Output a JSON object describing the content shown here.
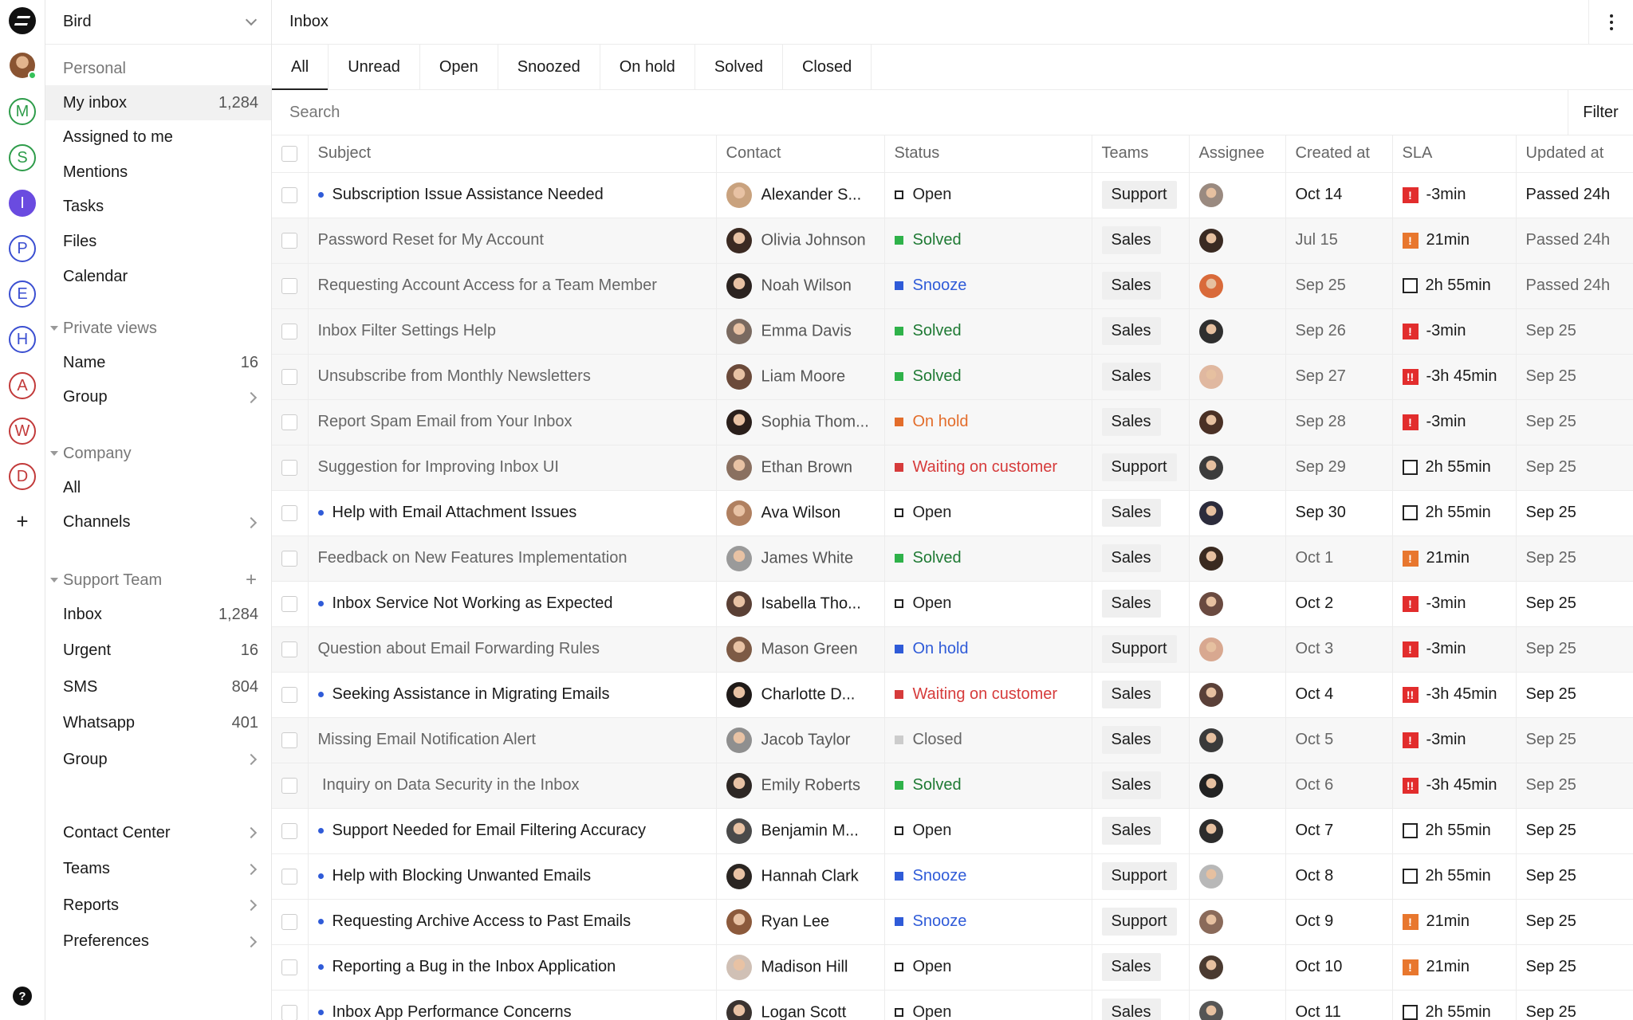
{
  "app": {
    "workspace": "Bird",
    "page_title": "Inbox"
  },
  "rail": {
    "items": [
      {
        "name": "logo",
        "letter": "",
        "color": "#111111"
      },
      {
        "name": "user-avatar",
        "letter": "",
        "color": "#b0703d"
      },
      {
        "name": "M",
        "letter": "M",
        "color": "#2e9c4a"
      },
      {
        "name": "S",
        "letter": "S",
        "color": "#2e9c4a"
      },
      {
        "name": "I",
        "letter": "I",
        "color": "#6a4be0",
        "filled": true
      },
      {
        "name": "P",
        "letter": "P",
        "color": "#3b4fd1"
      },
      {
        "name": "E",
        "letter": "E",
        "color": "#3b4fd1"
      },
      {
        "name": "H",
        "letter": "H",
        "color": "#3b4fd1"
      },
      {
        "name": "A",
        "letter": "A",
        "color": "#c23a3a"
      },
      {
        "name": "W",
        "letter": "W",
        "color": "#c23a3a"
      },
      {
        "name": "D",
        "letter": "D",
        "color": "#c23a3a"
      }
    ],
    "add": "+",
    "help": "?"
  },
  "sidebar": {
    "personal": {
      "title": "Personal",
      "items": [
        {
          "label": "My inbox",
          "count": "1,284"
        },
        {
          "label": "Assigned to me",
          "count": ""
        },
        {
          "label": "Mentions",
          "count": ""
        },
        {
          "label": "Tasks",
          "count": ""
        },
        {
          "label": "Files",
          "count": ""
        },
        {
          "label": "Calendar",
          "count": ""
        }
      ]
    },
    "private_views": {
      "title": "Private views",
      "items": [
        {
          "label": "Name",
          "count": "16"
        },
        {
          "label": "Group",
          "count": ""
        }
      ]
    },
    "company": {
      "title": "Company",
      "items": [
        {
          "label": "All",
          "count": ""
        },
        {
          "label": "Channels",
          "count": ""
        }
      ]
    },
    "support_team": {
      "title": "Support Team",
      "add": "+",
      "items": [
        {
          "label": "Inbox",
          "count": "1,284"
        },
        {
          "label": "Urgent",
          "count": "16"
        },
        {
          "label": "SMS",
          "count": "804"
        },
        {
          "label": "Whatsapp",
          "count": "401"
        },
        {
          "label": "Group",
          "count": ""
        }
      ]
    },
    "bottom": {
      "items": [
        {
          "label": "Contact Center"
        },
        {
          "label": "Teams"
        },
        {
          "label": "Reports"
        },
        {
          "label": "Preferences"
        }
      ]
    }
  },
  "tabs": [
    "All",
    "Unread",
    "Open",
    "Snoozed",
    "On hold",
    "Solved",
    "Closed"
  ],
  "search": {
    "placeholder": "Search",
    "filter_label": "Filter"
  },
  "columns": [
    "Subject",
    "Contact",
    "Status",
    "Teams",
    "Assignee",
    "Created at",
    "SLA",
    "Updated at"
  ],
  "status_colors": {
    "Open": "#222222",
    "Solved": "#2fb24a",
    "Snooze": "#2f5bd8",
    "On hold": "#e36d2b",
    "Waiting on customer": "#d63b3b",
    "Closed": "#cccccc"
  },
  "rows": [
    {
      "unread": true,
      "subject": "Subscription Issue Assistance Needed",
      "contact": "Alexander S...",
      "status": "Open",
      "team": "Support",
      "created": "Oct 14",
      "sla_type": "red",
      "sla": "-3min",
      "updated": "Passed 24h"
    },
    {
      "unread": false,
      "subject": "Password Reset for My Account",
      "contact": "Olivia Johnson",
      "status": "Solved",
      "team": "Sales",
      "created": "Jul 15",
      "sla_type": "orange",
      "sla": "21min",
      "updated": "Passed 24h"
    },
    {
      "unread": false,
      "subject": "Requesting Account Access for a Team Member",
      "contact": "Noah Wilson",
      "status": "Snooze",
      "team": "Sales",
      "created": "Sep 25",
      "sla_type": "box",
      "sla": "2h 55min",
      "updated": "Passed 24h"
    },
    {
      "unread": false,
      "subject": "Inbox Filter Settings Help",
      "contact": "Emma Davis",
      "status": "Solved",
      "team": "Sales",
      "created": "Sep 26",
      "sla_type": "red",
      "sla": "-3min",
      "updated": "Sep 25"
    },
    {
      "unread": false,
      "subject": "Unsubscribe from Monthly Newsletters",
      "contact": "Liam Moore",
      "status": "Solved",
      "team": "Sales",
      "created": "Sep 27",
      "sla_type": "red2",
      "sla": "-3h 45min",
      "updated": "Sep 25"
    },
    {
      "unread": false,
      "subject": "Report Spam Email from Your Inbox",
      "contact": "Sophia Thom...",
      "status": "On hold",
      "team": "Sales",
      "created": "Sep 28",
      "sla_type": "red",
      "sla": "-3min",
      "updated": "Sep 25"
    },
    {
      "unread": false,
      "subject": "Suggestion for Improving Inbox UI",
      "contact": "Ethan Brown",
      "status": "Waiting on customer",
      "team": "Support",
      "created": "Sep 29",
      "sla_type": "box",
      "sla": "2h 55min",
      "updated": "Sep 25"
    },
    {
      "unread": true,
      "subject": "Help with Email Attachment Issues",
      "contact": "Ava Wilson",
      "status": "Open",
      "team": "Sales",
      "created": "Sep 30",
      "sla_type": "box",
      "sla": "2h 55min",
      "updated": "Sep 25"
    },
    {
      "unread": false,
      "subject": "Feedback on New Features Implementation",
      "contact": "James White",
      "status": "Solved",
      "team": "Sales",
      "created": "Oct 1",
      "sla_type": "orange",
      "sla": "21min",
      "updated": "Sep 25"
    },
    {
      "unread": true,
      "subject": "Inbox Service Not Working as Expected",
      "contact": "Isabella Tho...",
      "status": "Open",
      "team": "Sales",
      "created": "Oct 2",
      "sla_type": "red",
      "sla": "-3min",
      "updated": "Sep 25"
    },
    {
      "unread": false,
      "subject": "Question about Email Forwarding Rules",
      "contact": "Mason Green",
      "status": "On hold",
      "status_color": "#2f5bd8",
      "team": "Support",
      "created": "Oct 3",
      "sla_type": "red",
      "sla": "-3min",
      "updated": "Sep 25"
    },
    {
      "unread": true,
      "subject": "Seeking Assistance in Migrating Emails",
      "contact": "Charlotte D...",
      "status": "Waiting on customer",
      "team": "Sales",
      "created": "Oct 4",
      "sla_type": "red2",
      "sla": "-3h 45min",
      "updated": "Sep 25"
    },
    {
      "unread": false,
      "subject": "Missing Email Notification Alert",
      "contact": "Jacob Taylor",
      "status": "Closed",
      "team": "Sales",
      "created": "Oct 5",
      "sla_type": "red",
      "sla": "-3min",
      "updated": "Sep 25"
    },
    {
      "unread": false,
      "subject": " Inquiry on Data Security in the Inbox",
      "contact": "Emily Roberts",
      "status": "Solved",
      "team": "Sales",
      "created": "Oct 6",
      "sla_type": "red2",
      "sla": "-3h 45min",
      "updated": "Sep 25"
    },
    {
      "unread": true,
      "subject": "Support Needed for Email Filtering Accuracy",
      "contact": "Benjamin M...",
      "status": "Open",
      "team": "Sales",
      "created": "Oct 7",
      "sla_type": "box",
      "sla": "2h 55min",
      "updated": "Sep 25"
    },
    {
      "unread": true,
      "subject": "Help with Blocking Unwanted Emails",
      "contact": "Hannah Clark",
      "status": "Snooze",
      "team": "Support",
      "created": "Oct 8",
      "sla_type": "box",
      "sla": "2h 55min",
      "updated": "Sep 25"
    },
    {
      "unread": true,
      "subject": "Requesting Archive Access to Past Emails",
      "contact": "Ryan Lee",
      "status": "Snooze",
      "team": "Support",
      "created": "Oct 9",
      "sla_type": "orange",
      "sla": "21min",
      "updated": "Sep 25"
    },
    {
      "unread": true,
      "subject": "Reporting a Bug in the Inbox Application",
      "contact": "Madison Hill",
      "status": "Open",
      "team": "Sales",
      "created": "Oct 10",
      "sla_type": "orange",
      "sla": "21min",
      "updated": "Sep 25"
    },
    {
      "unread": true,
      "subject": "Inbox App Performance Concerns",
      "contact": "Logan Scott",
      "status": "Open",
      "team": "Sales",
      "created": "Oct 11",
      "sla_type": "box",
      "sla": "2h 55min",
      "updated": "Sep 25"
    }
  ],
  "avatar_colors": [
    "#c9a27e",
    "#3b2a22",
    "#2b2320",
    "#7a6a60",
    "#6b4a3a",
    "#2a1f1b",
    "#8a7060",
    "#b08060",
    "#9a9a9a",
    "#5a4035",
    "#7d5a45",
    "#1f1a18",
    "#8f8f8f",
    "#2d2724",
    "#4a4a4a",
    "#2a2522",
    "#8c5a3c",
    "#d0c0b5",
    "#3a3330"
  ],
  "assignee_colors": [
    "#9a8a80",
    "#3a2a22",
    "#d96a3a",
    "#2f2f2f",
    "#e0b8a0",
    "#4a3025",
    "#3c3c3c",
    "#2c2c3c",
    "#3a2a20",
    "#6a4a40",
    "#d8a890",
    "#5a4038",
    "#3a3a3a",
    "#222222",
    "#2c2c2c",
    "#b8b8b8",
    "#8a6a5a",
    "#4a3a30",
    "#555555"
  ]
}
